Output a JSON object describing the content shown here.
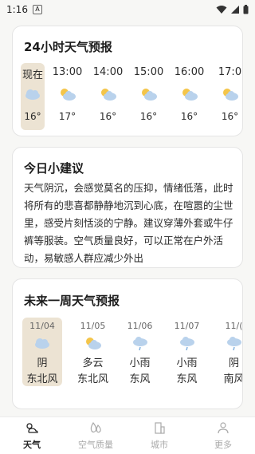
{
  "status": {
    "time": "1:16",
    "notif": "A"
  },
  "hourly": {
    "title": "24小时天气预报",
    "items": [
      {
        "time": "现在",
        "temp": "16°",
        "icon": "cloud-icon"
      },
      {
        "time": "13:00",
        "temp": "17°",
        "icon": "partly-cloudy-icon"
      },
      {
        "time": "14:00",
        "temp": "16°",
        "icon": "partly-cloudy-icon"
      },
      {
        "time": "15:00",
        "temp": "16°",
        "icon": "partly-cloudy-icon"
      },
      {
        "time": "16:00",
        "temp": "16°",
        "icon": "partly-cloudy-icon"
      },
      {
        "time": "17:0",
        "temp": "16°",
        "icon": "partly-cloudy-icon"
      }
    ]
  },
  "advice": {
    "title": "今日小建议",
    "text": "天气阴沉，会感觉莫名的压抑，情绪低落，此时将所有的悲喜都静静地沉到心底，在喧嚣的尘世里，感受片刻恬淡的宁静。建议穿薄外套或牛仔裤等服装。空气质量良好，可以正常在户外活动，易敏感人群应减少外出"
  },
  "weekly": {
    "title": "未来一周天气预报",
    "days": [
      {
        "date": "11/04",
        "cond": "阴",
        "wind": "东北风",
        "icon": "cloud-icon"
      },
      {
        "date": "11/05",
        "cond": "多云",
        "wind": "东北风",
        "icon": "partly-cloudy-icon"
      },
      {
        "date": "11/06",
        "cond": "小雨",
        "wind": "东风",
        "icon": "rain-icon"
      },
      {
        "date": "11/07",
        "cond": "小雨",
        "wind": "东风",
        "icon": "rain-icon"
      },
      {
        "date": "11/(",
        "cond": "阴",
        "wind": "南风",
        "icon": "rain-icon"
      }
    ]
  },
  "tabs": [
    {
      "label": "天气",
      "icon": "weather-icon",
      "active": true
    },
    {
      "label": "空气质量",
      "icon": "air-quality-icon",
      "active": false
    },
    {
      "label": "城市",
      "icon": "city-icon",
      "active": false
    },
    {
      "label": "更多",
      "icon": "person-icon",
      "active": false
    }
  ]
}
